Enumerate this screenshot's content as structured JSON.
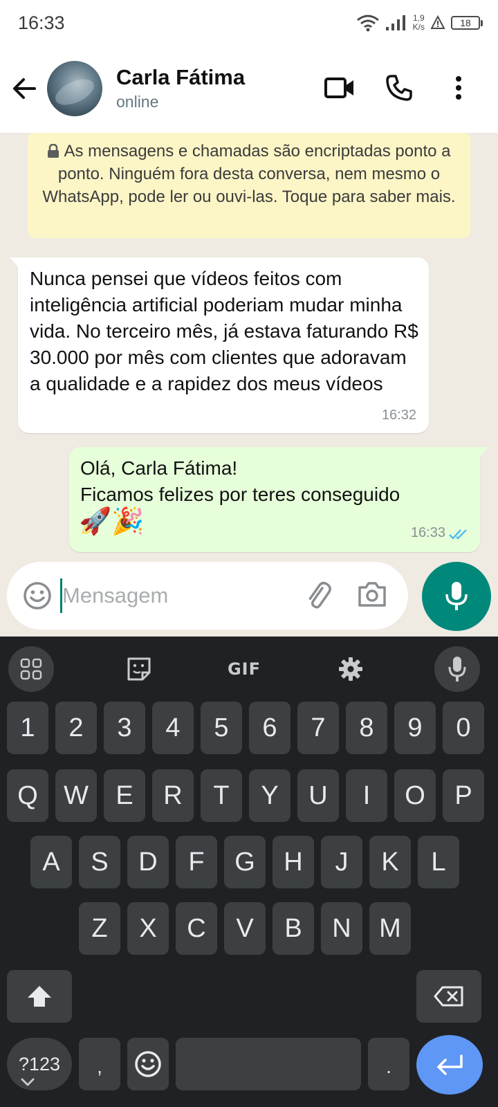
{
  "status_bar": {
    "time": "16:33",
    "net_speed_value": "1,9",
    "net_speed_unit": "K/s",
    "battery": "18"
  },
  "header": {
    "contact_name": "Carla Fátima",
    "contact_status": "online"
  },
  "chat": {
    "encryption_notice": "As mensagens e chamadas são encriptadas ponto a ponto. Ninguém fora desta conversa, nem mesmo o WhatsApp, pode ler ou ouvi-las. Toque para saber mais.",
    "messages": [
      {
        "direction": "incoming",
        "text": "Nunca pensei que vídeos feitos com inteligência artificial poderiam mudar minha vida. No terceiro mês, já estava faturando R$ 30.000 por mês com clientes que adoravam a qualidade e a rapidez dos meus vídeos",
        "time": "16:32"
      },
      {
        "direction": "outgoing",
        "line1": "Olá, Carla Fátima!",
        "line2": "Ficamos felizes por teres conseguido",
        "emoji": "🚀🎉",
        "time": "16:33",
        "status": "read"
      }
    ]
  },
  "composer": {
    "placeholder": "Mensagem",
    "value": ""
  },
  "keyboard": {
    "toolbar_gif": "GIF",
    "row_numbers": [
      "1",
      "2",
      "3",
      "4",
      "5",
      "6",
      "7",
      "8",
      "9",
      "0"
    ],
    "row_1": [
      "Q",
      "W",
      "E",
      "R",
      "T",
      "Y",
      "U",
      "I",
      "O",
      "P"
    ],
    "row_2": [
      "A",
      "S",
      "D",
      "F",
      "G",
      "H",
      "J",
      "K",
      "L"
    ],
    "row_3": [
      "Z",
      "X",
      "C",
      "V",
      "B",
      "N",
      "M"
    ],
    "symbols_key": "?123",
    "comma_key": ",",
    "period_key": "."
  },
  "colors": {
    "accent": "#00897b",
    "outgoing_bubble": "#e6ffda",
    "notice_bg": "#fcf5c6",
    "read_ticks": "#53bdeb",
    "keyboard_bg": "#202124",
    "key_bg": "#3c4043",
    "enter_key": "#5e97f6"
  }
}
